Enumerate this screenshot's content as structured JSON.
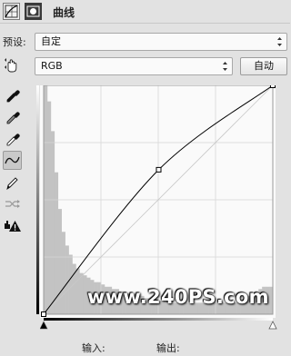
{
  "panel": {
    "title": "曲线"
  },
  "preset": {
    "label": "预设:",
    "value": "自定"
  },
  "channel": {
    "value": "RGB",
    "auto_label": "自动"
  },
  "footer": {
    "input_label": "输入:",
    "output_label": "输出:"
  },
  "watermark": {
    "text": "www.240PS.com"
  },
  "icons": {
    "header": [
      "adjustment-layer-icon",
      "mask-icon"
    ],
    "tools": [
      "target-adjust-hand-icon",
      "black-point-eyedropper-icon",
      "gray-point-eyedropper-icon",
      "white-point-eyedropper-icon",
      "curve-edit-points-icon",
      "pencil-draw-icon",
      "smooth-curve-icon",
      "clipping-warning-icon"
    ]
  },
  "colors": {
    "background": "#e2e2e2",
    "graph_background": "#fafafa",
    "grid": "#d6d6d6",
    "curve": "#000000",
    "histogram": "#c3c3c3"
  },
  "curve": {
    "points": [
      [
        0,
        0
      ],
      [
        128,
        161
      ],
      [
        255,
        255
      ]
    ],
    "input_range": [
      0,
      255
    ],
    "output_range": [
      0,
      255
    ]
  },
  "histogram": {
    "values": [
      1.0,
      0.93,
      0.8,
      0.62,
      0.46,
      0.36,
      0.3,
      0.26,
      0.22,
      0.2,
      0.18,
      0.17,
      0.16,
      0.15,
      0.14,
      0.14,
      0.13,
      0.12,
      0.12,
      0.11,
      0.11,
      0.1,
      0.1,
      0.09,
      0.09,
      0.08,
      0.08,
      0.08,
      0.07,
      0.07,
      0.07,
      0.06,
      0.06,
      0.06,
      0.06,
      0.05,
      0.05,
      0.05,
      0.05,
      0.05,
      0.05,
      0.05,
      0.05,
      0.05,
      0.05,
      0.05,
      0.05,
      0.05,
      0.05,
      0.05,
      0.05,
      0.05,
      0.05,
      0.05,
      0.06,
      0.06,
      0.07,
      0.08,
      0.09,
      0.1,
      0.11,
      0.12,
      0.12,
      0.12
    ]
  }
}
